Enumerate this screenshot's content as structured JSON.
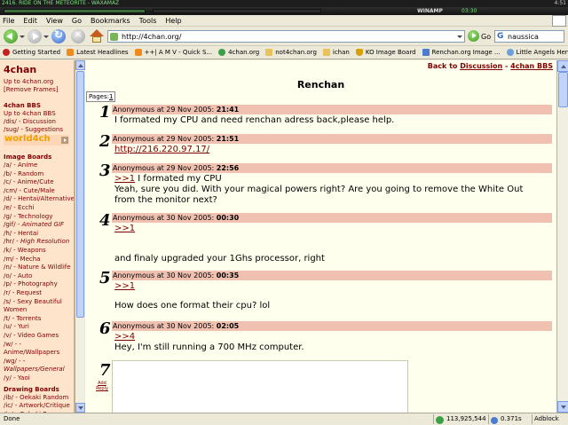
{
  "winamp": {
    "track": "2416. RIDE ON THE METEORITE - WAXAMAZ",
    "logo": "WINAMP",
    "time": "03:30",
    "clock": "4:51"
  },
  "menu": [
    "File",
    "Edit",
    "View",
    "Go",
    "Bookmarks",
    "Tools",
    "Help"
  ],
  "address": {
    "url": "http://4chan.org/"
  },
  "go_label": "Go",
  "search": {
    "value": "naussica"
  },
  "bookmarks": [
    {
      "label": "Getting Started",
      "icon": "red-dot-icon"
    },
    {
      "label": "Latest Headlines",
      "icon": "rss-icon"
    },
    {
      "label": "++| A M V - Quick S...",
      "icon": "rss-icon"
    },
    {
      "label": "4chan.org",
      "icon": "clover-icon"
    },
    {
      "label": "not4chan.org",
      "icon": "folder-icon"
    },
    {
      "label": "ichan",
      "icon": "folder-icon"
    },
    {
      "label": "KO Image Board",
      "icon": "shield-icon"
    },
    {
      "label": "Renchan.org Image ...",
      "icon": "blue-page-icon"
    },
    {
      "label": "Little Angels Hentai :...",
      "icon": "globe-icon"
    }
  ],
  "sidebar": {
    "title": "4chan",
    "links_top": [
      "Up to 4chan.org",
      "[Remove Frames]"
    ],
    "bbs_head": "4chan BBS",
    "bbs_links": [
      "Up to 4chan BBS",
      "/dis/ - Discussion",
      "/sug/ - Suggestions"
    ],
    "world": "world4ch",
    "image_head": "Image Boards",
    "boards": [
      {
        "code": "/a/",
        "name": "Anime"
      },
      {
        "code": "/b/",
        "name": "Random"
      },
      {
        "code": "/c/",
        "name": "Anime/Cute"
      },
      {
        "code": "/cm/",
        "name": "Cute/Male"
      },
      {
        "code": "/d/",
        "name": "Hentai/Alternative"
      },
      {
        "code": "/e/",
        "name": "Ecchi"
      },
      {
        "code": "/g/",
        "name": "Technology"
      },
      {
        "code": "/gif/",
        "name": "Animated GIF",
        "italic": true
      },
      {
        "code": "/h/",
        "name": "Hentai"
      },
      {
        "code": "/hr/",
        "name": "High Resolution",
        "italic": true
      },
      {
        "code": "/k/",
        "name": "Weapons"
      },
      {
        "code": "/m/",
        "name": "Mecha"
      },
      {
        "code": "/n/",
        "name": "Nature & Wildlife"
      },
      {
        "code": "/o/",
        "name": "Auto"
      },
      {
        "code": "/p/",
        "name": "Photography"
      },
      {
        "code": "/r/",
        "name": "Request"
      },
      {
        "code": "/s/",
        "name": "Sexy Beautiful"
      },
      {
        "code": "",
        "name": "Women"
      },
      {
        "code": "/t/",
        "name": "Torrents"
      },
      {
        "code": "/u/",
        "name": "Yuri"
      },
      {
        "code": "/v/",
        "name": "Video Games"
      },
      {
        "code": "/w/",
        "name": "-"
      },
      {
        "code": "",
        "name": "Anime/Wallpapers"
      },
      {
        "code": "/wg/",
        "name": "-",
        "italic": true
      },
      {
        "code": "",
        "name": "Wallpapers/General",
        "italic": true
      },
      {
        "code": "/y/",
        "name": "Yaoi"
      }
    ],
    "draw_head": "Drawing Boards",
    "draw_boards": [
      {
        "code": "/ib/",
        "name": "Oekaki Random"
      },
      {
        "code": "/ic/",
        "name": "Artwork/Critique"
      },
      {
        "code": "/in/",
        "name": "Oekaki Pro"
      }
    ]
  },
  "main": {
    "backto_prefix": "Back to",
    "backto_discussion": "Discussion",
    "backto_sep": "-",
    "backto_bbs": "4chan BBS",
    "pages_label": "Pages:",
    "pages_value": "1",
    "thread_title": "Renchan",
    "reply_number": "7",
    "add_reply_line1": "Add",
    "add_reply_line2": "Reply",
    "posts": [
      {
        "num": "1",
        "author": "Anonymous at 29 Nov 2005:",
        "time": "21:41",
        "lines": [
          "I formated my CPU and need renchan adress back,please help."
        ]
      },
      {
        "num": "2",
        "author": "Anonymous at 29 Nov 2005:",
        "time": "21:51",
        "link": "http://216.220.97.17/"
      },
      {
        "num": "3",
        "author": "Anonymous at 29 Nov 2005:",
        "time": "22:56",
        "ref": ">>1",
        "ref_suffix": " I formated my CPU",
        "lines": [
          "Yeah, sure you did. With your magical powers right? Are you going to remove the White Out",
          "from the monitor next?"
        ]
      },
      {
        "num": "4",
        "author": "Anonymous at 30 Nov 2005:",
        "time": "00:30",
        "ref": ">>1",
        "lines": [
          "and finaly upgraded your 1Ghs processor, right"
        ]
      },
      {
        "num": "5",
        "author": "Anonymous at 30 Nov 2005:",
        "time": "00:35",
        "ref": ">>1",
        "lines": [
          "How does one format their cpu? lol"
        ]
      },
      {
        "num": "6",
        "author": "Anonymous at 30 Nov 2005:",
        "time": "02:05",
        "ref": ">>4",
        "lines": [
          "Hey, I'm still running a 700 MHz computer."
        ]
      }
    ]
  },
  "status": {
    "text": "Done",
    "counter": "113,925,544",
    "timing": "0.371s",
    "adblock": "Adblock"
  }
}
